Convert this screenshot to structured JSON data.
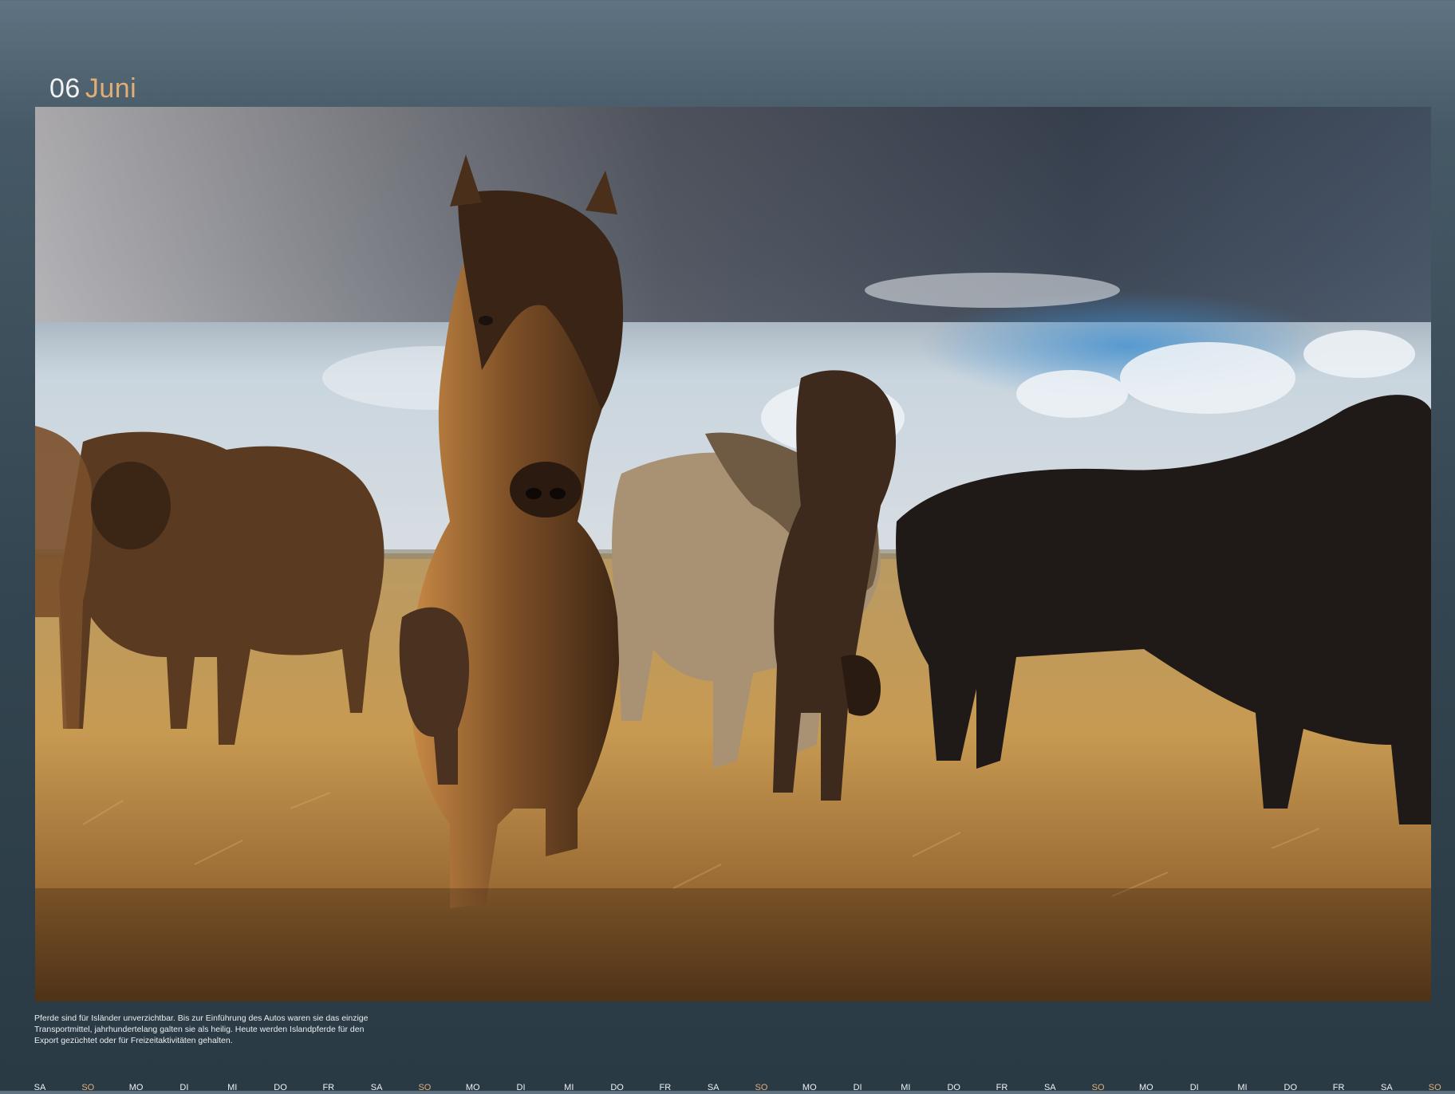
{
  "header": {
    "month_number": "06",
    "month_name": "Juni"
  },
  "caption": "Pferde sind für Isländer unverzichtbar. Bis zur Einführung des Autos waren sie das einzige Transportmittel, jahrhundertelang galten sie als heilig. Heute werden Islandpferde für den Export gezüchtet oder für Freizeitaktivitäten gehalten.",
  "photo": {
    "subject": "Icelandic horses on grassland under a stormy sky"
  },
  "weekdays": [
    "SA",
    "SO",
    "MO",
    "DI",
    "MI",
    "DO",
    "FR",
    "SA",
    "SO",
    "MO",
    "DI",
    "MI",
    "DO",
    "FR",
    "SA",
    "SO",
    "MO",
    "DI",
    "MI",
    "DO",
    "FR",
    "SA",
    "SO",
    "MO",
    "DI",
    "MI",
    "DO",
    "FR",
    "SA",
    "SO"
  ],
  "colors": {
    "accent_orange": "#e2ad77",
    "background": "#3b4d59",
    "text_light": "#eef2f4"
  }
}
